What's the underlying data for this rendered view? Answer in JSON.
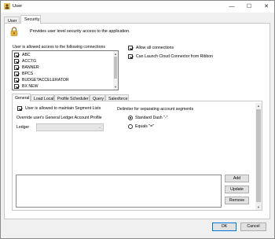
{
  "window": {
    "title": "User",
    "minimize": "—",
    "maximize": "☐",
    "close": "✕"
  },
  "top_tabs": [
    {
      "label": "User"
    },
    {
      "label": "Security"
    }
  ],
  "security": {
    "description": "Provides user level security access to the application.",
    "connections_label": "User is allowed access to the following connections",
    "connections": [
      {
        "label": "ABC",
        "checked": true
      },
      {
        "label": "ACCTG",
        "checked": true
      },
      {
        "label": "BANNER",
        "checked": true
      },
      {
        "label": "BPCS",
        "checked": true
      },
      {
        "label": "BUDGETACCELERATOR",
        "checked": true
      },
      {
        "label": "BX NEW",
        "checked": true
      }
    ],
    "allow_all_connections": {
      "label": "Allow all connections",
      "checked": true
    },
    "launch_cloud_connector": {
      "label": "Can Launch Cloud Connector from Ribbon",
      "checked": true
    }
  },
  "inner_tabs": [
    {
      "label": "General",
      "active": true
    },
    {
      "label": "Load Local"
    },
    {
      "label": "Profile Scheduler"
    },
    {
      "label": "Query"
    },
    {
      "label": "Salesforce"
    }
  ],
  "general": {
    "maintain_segment_lists": {
      "label": "User is allowed to maintain Segment Lists",
      "checked": true
    },
    "override_label": "Override user's General Ledger Account Profile",
    "ledger_label": "Ledger",
    "ledger_value": "",
    "delimiter_label": "Delimiter for separating account segments",
    "delimiter_options": [
      {
        "label": "Standard Dash \"-\"",
        "selected": true
      },
      {
        "label": "Equals \"=\"",
        "selected": false
      }
    ]
  },
  "buttons": {
    "add": "Add",
    "update": "Update",
    "remove": "Remove",
    "ok": "OK",
    "cancel": "Cancel"
  },
  "icons": {
    "app": "user-icon",
    "lock": "lock-icon"
  }
}
